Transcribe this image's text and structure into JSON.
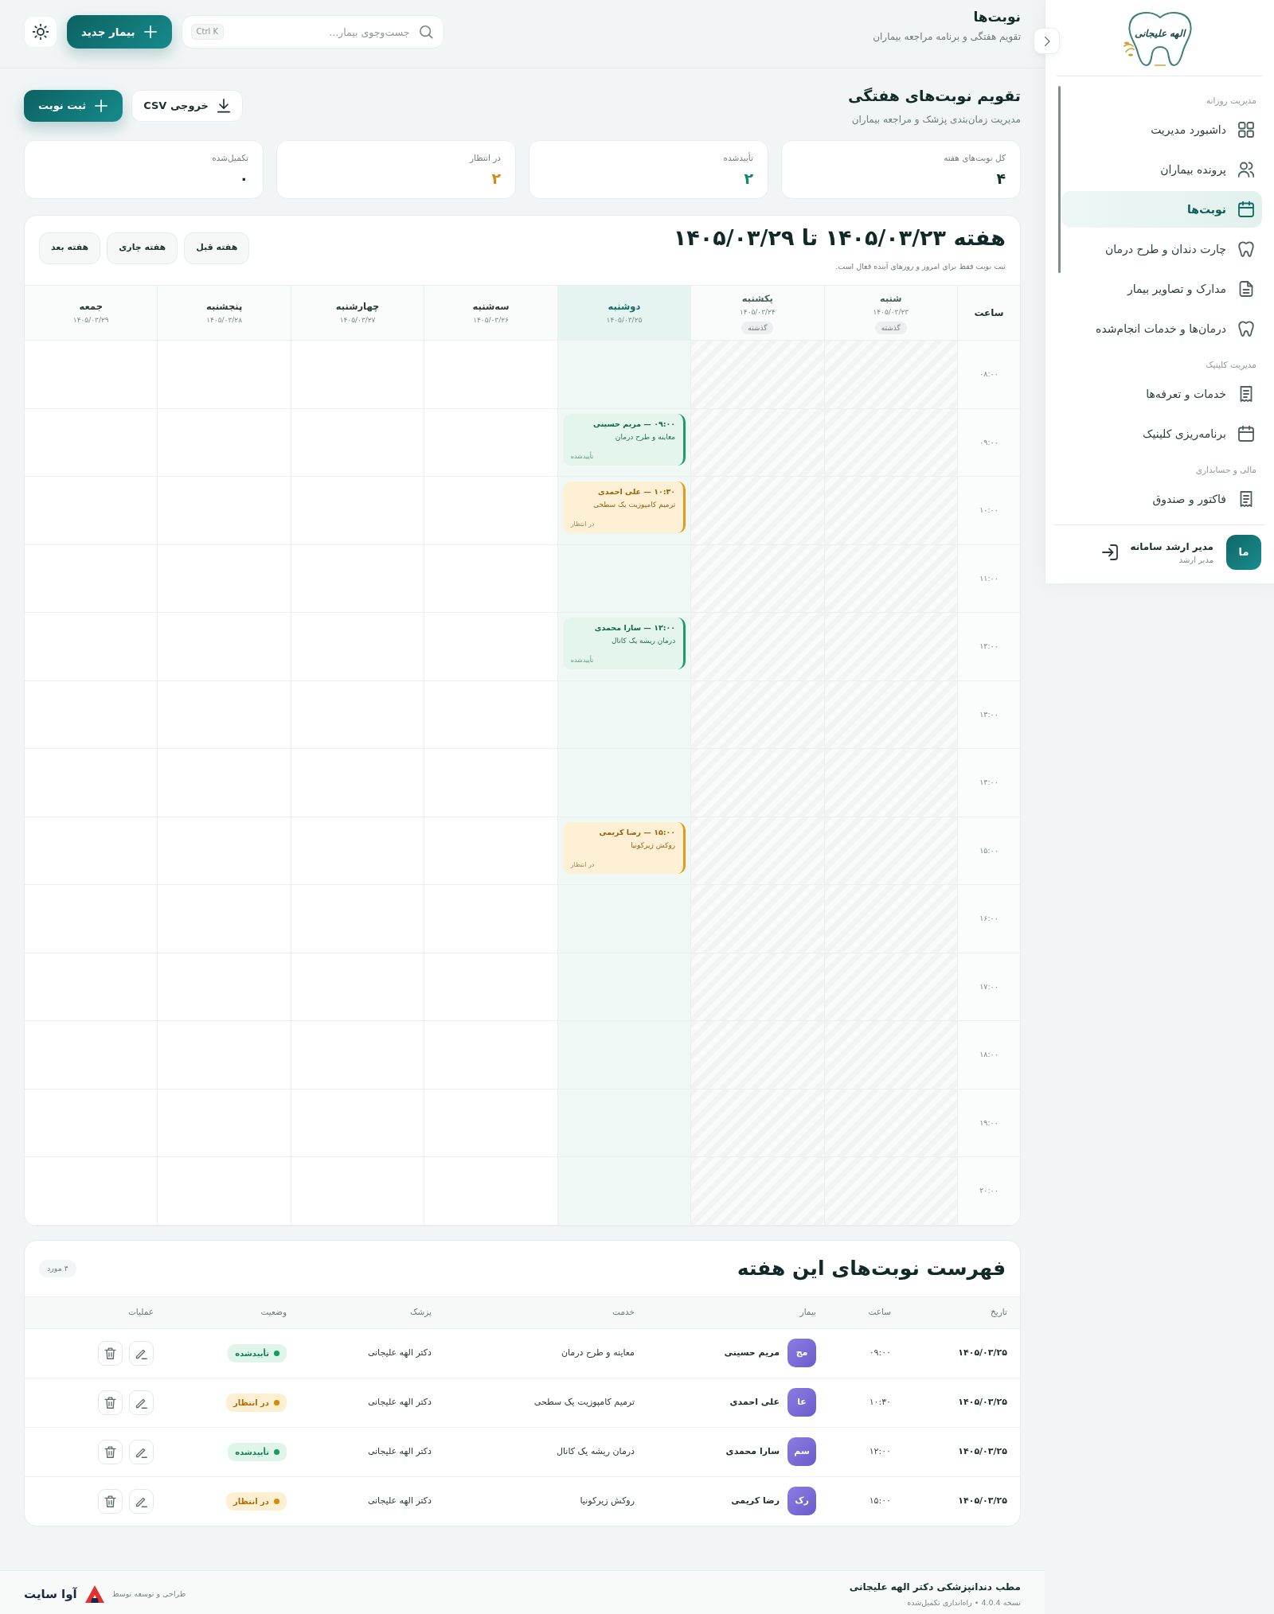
{
  "sidebar": {
    "logo_text": "الهه علیجانی",
    "sections": [
      {
        "title": "مدیریت روزانه",
        "items": [
          {
            "label": "داشبورد مدیریت",
            "selected": false
          },
          {
            "label": "پرونده بیماران",
            "selected": false
          },
          {
            "label": "نوبت‌ها",
            "selected": true
          },
          {
            "label": "چارت دندان و طرح درمان",
            "selected": false
          },
          {
            "label": "مدارک و تصاویر بیمار",
            "selected": false
          },
          {
            "label": "درمان‌ها و خدمات انجام‌شده",
            "selected": false
          }
        ]
      },
      {
        "title": "مدیریت کلینیک",
        "items": [
          {
            "label": "خدمات و تعرفه‌ها",
            "selected": false
          },
          {
            "label": "برنامه‌ریزی کلینیک",
            "selected": false
          }
        ]
      },
      {
        "title": "مالی و حسابداری",
        "items": [
          {
            "label": "فاکتور و صندوق",
            "selected": false
          }
        ]
      }
    ],
    "user": {
      "initials": "ما",
      "name": "مدیر ارشد سامانه",
      "role": "مدیر ارشد"
    }
  },
  "header": {
    "title": "نوبت‌ها",
    "subtitle": "تقویم هفتگی و برنامه مراجعه بیماران",
    "search": {
      "placeholder": "جست‌وجوی بیمار...",
      "shortcut": "Ctrl K"
    },
    "new_button": "بیمار جدید"
  },
  "page": {
    "title": "تقویم نوبت‌های هفتگی",
    "subtitle": "مدیریت زمان‌بندی پزشک و مراجعه بیماران",
    "actions": [
      {
        "label": "خروجی CSV",
        "kind": "export"
      },
      {
        "label": "ثبت نوبت",
        "kind": "primary"
      }
    ]
  },
  "stats": [
    {
      "label": "کل نوبت‌های هفته",
      "value": "۴",
      "color": "#16302d"
    },
    {
      "label": "تأییدشده",
      "value": "۲",
      "color": "#15866a"
    },
    {
      "label": "در انتظار",
      "value": "۲",
      "color": "#d38b12"
    },
    {
      "label": "تکمیل‌شده",
      "value": "۰",
      "color": "#16302d"
    }
  ],
  "calendar": {
    "title": "هفته ۱۴۰۵/۰۳/۲۳ تا ۱۴۰۵/۰۳/۲۹",
    "note": "ثبت نوبت فقط برای امروز و روزهای آینده فعال است.",
    "nav": [
      "هفته قبل",
      "هفته جاری",
      "هفته بعد"
    ],
    "time_header": "ساعت",
    "days": [
      {
        "name": "شنبه",
        "date": "۱۴۰۵/۰۳/۲۳",
        "kind": "past",
        "badge": "گذشته"
      },
      {
        "name": "یکشنبه",
        "date": "۱۴۰۵/۰۳/۲۴",
        "kind": "past",
        "badge": "گذشته"
      },
      {
        "name": "دوشنبه",
        "date": "۱۴۰۵/۰۳/۲۵",
        "kind": "today"
      },
      {
        "name": "سه‌شنبه",
        "date": "۱۴۰۵/۰۳/۲۶",
        "kind": "upcoming"
      },
      {
        "name": "چهارشنبه",
        "date": "۱۴۰۵/۰۳/۲۷",
        "kind": "upcoming"
      },
      {
        "name": "پنجشنبه",
        "date": "۱۴۰۵/۰۳/۲۸",
        "kind": "upcoming"
      },
      {
        "name": "جمعه",
        "date": "۱۴۰۵/۰۳/۲۹",
        "kind": "upcoming"
      }
    ],
    "rows": [
      {
        "time": "۰۸:۰۰",
        "cells": [
          null,
          null,
          null,
          null,
          null,
          null,
          null
        ]
      },
      {
        "time": "۰۹:۰۰",
        "cells": [
          null,
          null,
          {
            "title": "۰۹:۰۰ — مریم حسینی",
            "service": "معاینه و طرح درمان",
            "status": "تأییدشده",
            "kind": "confirmed"
          },
          null,
          null,
          null,
          null
        ]
      },
      {
        "time": "۱۰:۰۰",
        "cells": [
          null,
          null,
          {
            "title": "۱۰:۳۰ — علی احمدی",
            "service": "ترمیم کامپوزیت یک سطحی",
            "status": "در انتظار",
            "kind": "pending"
          },
          null,
          null,
          null,
          null
        ]
      },
      {
        "time": "۱۱:۰۰",
        "cells": [
          null,
          null,
          null,
          null,
          null,
          null,
          null
        ]
      },
      {
        "time": "۱۲:۰۰",
        "cells": [
          null,
          null,
          {
            "title": "۱۲:۰۰ — سارا محمدی",
            "service": "درمان ریشه یک کانال",
            "status": "تأییدشده",
            "kind": "confirmed"
          },
          null,
          null,
          null,
          null
        ]
      },
      {
        "time": "۱۳:۰۰",
        "cells": [
          null,
          null,
          null,
          null,
          null,
          null,
          null
        ]
      },
      {
        "time": "۱۴:۰۰",
        "cells": [
          null,
          null,
          null,
          null,
          null,
          null,
          null
        ]
      },
      {
        "time": "۱۵:۰۰",
        "cells": [
          null,
          null,
          {
            "title": "۱۵:۰۰ — رضا کریمی",
            "service": "روکش زیرکونیا",
            "status": "در انتظار",
            "kind": "pending"
          },
          null,
          null,
          null,
          null
        ]
      },
      {
        "time": "۱۶:۰۰",
        "cells": [
          null,
          null,
          null,
          null,
          null,
          null,
          null
        ]
      },
      {
        "time": "۱۷:۰۰",
        "cells": [
          null,
          null,
          null,
          null,
          null,
          null,
          null
        ]
      },
      {
        "time": "۱۸:۰۰",
        "cells": [
          null,
          null,
          null,
          null,
          null,
          null,
          null
        ]
      },
      {
        "time": "۱۹:۰۰",
        "cells": [
          null,
          null,
          null,
          null,
          null,
          null,
          null
        ]
      },
      {
        "time": "۲۰:۰۰",
        "cells": [
          null,
          null,
          null,
          null,
          null,
          null,
          null
        ]
      }
    ]
  },
  "appointments": {
    "title": "فهرست نوبت‌های این هفته",
    "count": "۴ مورد",
    "columns": [
      "تاریخ",
      "ساعت",
      "بیمار",
      "خدمت",
      "پزشک",
      "وضعیت",
      "عملیات"
    ],
    "rows": [
      {
        "date": "۱۴۰۵/۰۳/۲۵",
        "time": "۰۹:۰۰",
        "initials": "مج",
        "patient": "مریم حسینی",
        "service": "معاینه و طرح درمان",
        "doctor": "دکتر الهه علیجانی",
        "status": "تأییدشده",
        "kind": "confirmed"
      },
      {
        "date": "۱۴۰۵/۰۳/۲۵",
        "time": "۱۰:۳۰",
        "initials": "عا",
        "patient": "علی احمدی",
        "service": "ترمیم کامپوزیت یک سطحی",
        "doctor": "دکتر الهه علیجانی",
        "status": "در انتظار",
        "kind": "pending"
      },
      {
        "date": "۱۴۰۵/۰۳/۲۵",
        "time": "۱۲:۰۰",
        "initials": "سم",
        "patient": "سارا محمدی",
        "service": "درمان ریشه یک کانال",
        "doctor": "دکتر الهه علیجانی",
        "status": "تأییدشده",
        "kind": "confirmed"
      },
      {
        "date": "۱۴۰۵/۰۳/۲۵",
        "time": "۱۵:۰۰",
        "initials": "رک",
        "patient": "رضا کریمی",
        "service": "روکش زیرکونیا",
        "doctor": "دکتر الهه علیجانی",
        "status": "در انتظار",
        "kind": "pending"
      }
    ]
  },
  "footer": {
    "clinic": "مطب دندانپزشکی دکتر الهه علیجانی",
    "version": "نسخه 4.0.4 • راه‌اندازی تکمیل‌شده",
    "credit": "طراحی و توسعه توسط",
    "brand": "آوا سایت"
  }
}
